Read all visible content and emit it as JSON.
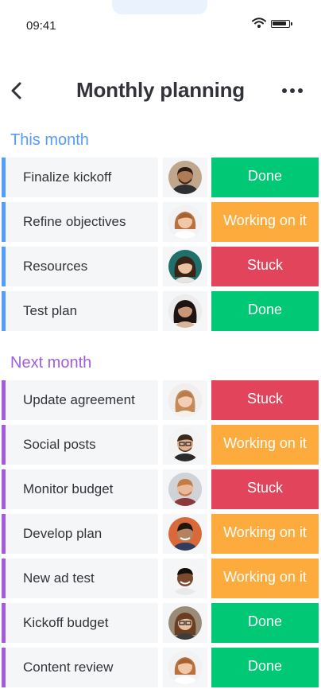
{
  "status_bar": {
    "time": "09:41"
  },
  "header": {
    "title": "Monthly planning"
  },
  "status_colors": {
    "Done": "#00c875",
    "Working on it": "#fdab3d",
    "Stuck": "#e2445c"
  },
  "groups": [
    {
      "title": "This month",
      "color": "#579bfc",
      "items": [
        {
          "name": "Finalize kickoff",
          "status": "Done"
        },
        {
          "name": "Refine objectives",
          "status": "Working on it"
        },
        {
          "name": "Resources",
          "status": "Stuck"
        },
        {
          "name": "Test plan",
          "status": "Done"
        }
      ]
    },
    {
      "title": "Next month",
      "color": "#a25ddc",
      "items": [
        {
          "name": "Update agreement",
          "status": "Stuck"
        },
        {
          "name": "Social posts",
          "status": "Working on it"
        },
        {
          "name": "Monitor budget",
          "status": "Stuck"
        },
        {
          "name": "Develop plan",
          "status": "Working on it"
        },
        {
          "name": "New ad test",
          "status": "Working on it"
        },
        {
          "name": "Kickoff budget",
          "status": "Done"
        },
        {
          "name": "Content review",
          "status": "Done"
        }
      ]
    }
  ]
}
